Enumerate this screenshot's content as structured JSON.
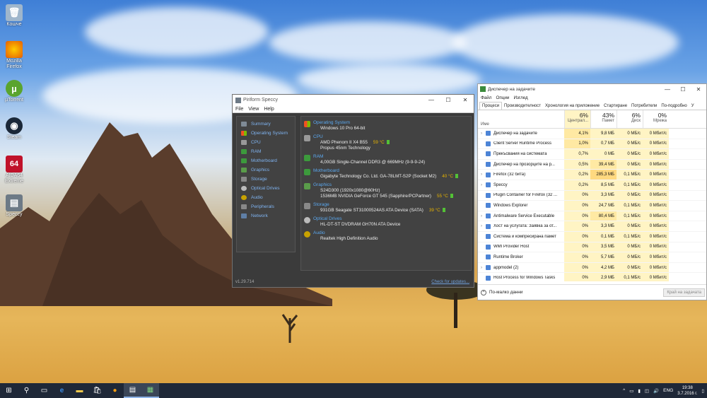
{
  "desktop": {
    "icons": [
      {
        "label": "Кошче",
        "icon": "recycle-bin-icon"
      },
      {
        "label": "Mozilla Firefox",
        "icon": "firefox-icon"
      },
      {
        "label": "µTorrent",
        "icon": "utorrent-icon"
      },
      {
        "label": "Steam",
        "icon": "steam-icon"
      },
      {
        "label": "AIDA64 Extreme",
        "icon": "aida64-icon"
      },
      {
        "label": "Speccy",
        "icon": "speccy-icon"
      }
    ]
  },
  "speccy": {
    "title": "Piriform Speccy",
    "menu": [
      "File",
      "View",
      "Help"
    ],
    "nav": [
      "Summary",
      "Operating System",
      "CPU",
      "RAM",
      "Motherboard",
      "Graphics",
      "Storage",
      "Optical Drives",
      "Audio",
      "Peripherals",
      "Network"
    ],
    "sections": {
      "os": {
        "header": "Operating System",
        "line1": "Windows 10 Pro 64-bit"
      },
      "cpu": {
        "header": "CPU",
        "line1": "AMD Phenom II X4 B55",
        "temp": "59 °C",
        "line2": "Propus 45nm Technology"
      },
      "ram": {
        "header": "RAM",
        "line1": "4,00GB Single-Channel DDR3 @ 669MHz (9-9-9-24)"
      },
      "mb": {
        "header": "Motherboard",
        "line1": "Gigabyte Technology Co. Ltd. GA-78LMT-S2P (Socket M2)",
        "temp": "40 °C"
      },
      "gfx": {
        "header": "Graphics",
        "line1": "S24D300 (1920x1080@60Hz)",
        "line2": "1536MB NVIDIA GeForce GT 545 (Sapphire/PCPartner)",
        "temp": "55 °C"
      },
      "storage": {
        "header": "Storage",
        "line1": "931GB Seagate ST31000524AS ATA Device (SATA)",
        "temp": "39 °C"
      },
      "optical": {
        "header": "Optical Drives",
        "line1": "HL-DT-ST DVDRAM GH70N ATA Device"
      },
      "audio": {
        "header": "Audio",
        "line1": "Realtek High Definition Audio"
      }
    },
    "version": "v1.29.714",
    "update_link": "Check for updates..."
  },
  "taskmgr": {
    "title": "Диспечер на задачите",
    "menu": [
      "Файл",
      "Опции",
      "Изглед"
    ],
    "tabs": [
      "Процеси",
      "Производителност",
      "Хронология на приложение",
      "Стартиране",
      "Потребители",
      "По-подробно",
      "У"
    ],
    "columns": {
      "name": "Име",
      "cpu": {
        "pct": "6%",
        "label": "Централ..."
      },
      "mem": {
        "pct": "43%",
        "label": "Памет"
      },
      "disk": {
        "pct": "6%",
        "label": "Диск"
      },
      "net": {
        "pct": "0%",
        "label": "Мрежа"
      }
    },
    "rows": [
      {
        "name": "Диспечер на задачите",
        "cpu": "4,1%",
        "mem": "9,8 МБ",
        "disk": "0 МБ/с",
        "net": "0 Мбит/с",
        "exp": "›"
      },
      {
        "name": "Client Server Runtime Process",
        "cpu": "1,0%",
        "mem": "0,7 МБ",
        "disk": "0 МБ/с",
        "net": "0 Мбит/с",
        "exp": ""
      },
      {
        "name": "Прекъсвания на системата",
        "cpu": "0,7%",
        "mem": "0 МБ",
        "disk": "0 МБ/с",
        "net": "0 Мбит/с",
        "exp": ""
      },
      {
        "name": "Диспечер на прозорците на р...",
        "cpu": "0,5%",
        "mem": "39,4 МБ",
        "disk": "0 МБ/с",
        "net": "0 Мбит/с",
        "exp": ""
      },
      {
        "name": "Firefox (32 бита)",
        "cpu": "0,2%",
        "mem": "285,3 МБ",
        "disk": "0,1 МБ/с",
        "net": "0 Мбит/с",
        "exp": "›"
      },
      {
        "name": "Speccy",
        "cpu": "0,2%",
        "mem": "8,5 МБ",
        "disk": "0,1 МБ/с",
        "net": "0 Мбит/с",
        "exp": "›"
      },
      {
        "name": "Plugin Container for Firefox (32 ...",
        "cpu": "0%",
        "mem": "3,3 МБ",
        "disk": "0 МБ/с",
        "net": "0 Мбит/с",
        "exp": ""
      },
      {
        "name": "Windows Explorer",
        "cpu": "0%",
        "mem": "24,7 МБ",
        "disk": "0,1 МБ/с",
        "net": "0 Мбит/с",
        "exp": ""
      },
      {
        "name": "Antimalware Service Executable",
        "cpu": "0%",
        "mem": "80,4 МБ",
        "disk": "0,1 МБ/с",
        "net": "0 Мбит/с",
        "exp": "›"
      },
      {
        "name": "Хост на услугата: Заявка за от...",
        "cpu": "0%",
        "mem": "3,3 МБ",
        "disk": "0 МБ/с",
        "net": "0 Мбит/с",
        "exp": "›"
      },
      {
        "name": "Система и компресирана памет",
        "cpu": "0%",
        "mem": "0,1 МБ",
        "disk": "0,1 МБ/с",
        "net": "0 Мбит/с",
        "exp": ""
      },
      {
        "name": "WMI Provider Host",
        "cpu": "0%",
        "mem": "3,5 МБ",
        "disk": "0 МБ/с",
        "net": "0 Мбит/с",
        "exp": ""
      },
      {
        "name": "Runtime Broker",
        "cpu": "0%",
        "mem": "5,7 МБ",
        "disk": "0 МБ/с",
        "net": "0 Мбит/с",
        "exp": ""
      },
      {
        "name": "appmodel (2)",
        "cpu": "0%",
        "mem": "4,2 МБ",
        "disk": "0 МБ/с",
        "net": "0 Мбит/с",
        "exp": "›"
      },
      {
        "name": "Host Process for Windows Tasks",
        "cpu": "0%",
        "mem": "2,9 МБ",
        "disk": "0,1 МБ/с",
        "net": "0 Мбит/с",
        "exp": ""
      }
    ],
    "fewer_details": "По-малко данни",
    "end_task": "Край на задачата"
  },
  "taskbar": {
    "lang": "ENG",
    "time": "19:38",
    "date": "3.7.2016 г."
  }
}
